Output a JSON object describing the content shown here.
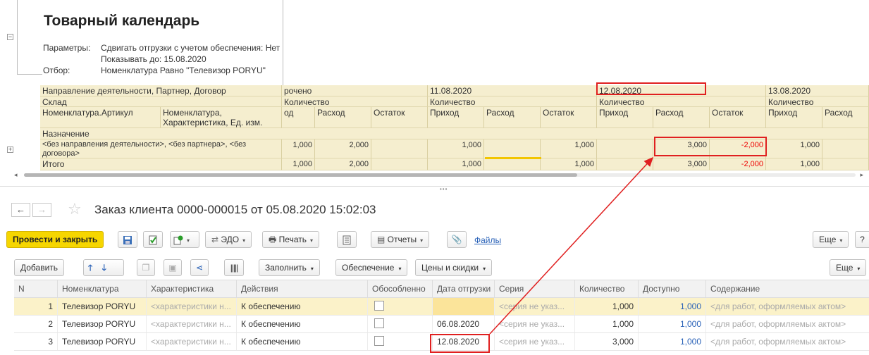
{
  "report": {
    "title": "Товарный календарь",
    "params": [
      {
        "label": "Параметры:",
        "value": "Сдвигать отгрузки с учетом обеспечения: Нет"
      },
      {
        "label": "",
        "value": "Показывать до: 15.08.2020"
      },
      {
        "label": "Отбор:",
        "value": "Номенклатура Равно \"Телевизор PORYU\""
      }
    ],
    "grid": {
      "hdr_direction": "Направление деятельности, Партнер, Договор",
      "hdr_warehouse": "Склад",
      "hdr_article": "Номенклатура.Артикул",
      "hdr_characteristic": "Номенклатура, Характеристика, Ед. изм.",
      "hdr_purpose": "Назначение",
      "overdue_label": "рочено",
      "qty_label": "Количество",
      "col_in_partial": "од",
      "dates": [
        "11.08.2020",
        "12.08.2020",
        "13.08.2020"
      ],
      "col_in": "Приход",
      "col_out": "Расход",
      "col_rest": "Остаток",
      "row_label": "<без направления деятельности>, <без партнера>, <без договора>",
      "row_vals": [
        "1,000",
        "2,000",
        "",
        "1,000",
        "",
        "1,000",
        "",
        "3,000",
        "-2,000",
        "1,000"
      ],
      "total_label": "Итого",
      "total_vals": [
        "1,000",
        "2,000",
        "",
        "1,000",
        "",
        "1,000",
        "",
        "3,000",
        "-2,000",
        "1,000"
      ]
    }
  },
  "doc": {
    "title": "Заказ клиента 0000-000015 от 05.08.2020 15:02:03",
    "buttons": {
      "post_close": "Провести и закрыть",
      "edo": "ЭДО",
      "print": "Печать",
      "reports": "Отчеты",
      "files": "Файлы",
      "more": "Еще",
      "help": "?"
    },
    "table_toolbar": {
      "add": "Добавить",
      "fill": "Заполнить",
      "supply": "Обеспечение",
      "prices": "Цены и скидки",
      "more": "Еще"
    },
    "columns": [
      "N",
      "Номенклатура",
      "Характеристика",
      "Действия",
      "Обособленно",
      "Дата отгрузки",
      "Серия",
      "Количество",
      "Доступно",
      "Содержание"
    ],
    "rows": [
      {
        "n": "1",
        "item": "Телевизор PORYU",
        "char": "<характеристики н...",
        "action": "К обеспечению",
        "date": "",
        "series": "<серия не указ...",
        "qty": "1,000",
        "avail": "1,000",
        "content": "<для работ, оформляемых актом>"
      },
      {
        "n": "2",
        "item": "Телевизор PORYU",
        "char": "<характеристики н...",
        "action": "К обеспечению",
        "date": "06.08.2020",
        "series": "<серия не указ...",
        "qty": "1,000",
        "avail": "1,000",
        "content": "<для работ, оформляемых актом>"
      },
      {
        "n": "3",
        "item": "Телевизор PORYU",
        "char": "<характеристики н...",
        "action": "К обеспечению",
        "date": "12.08.2020",
        "series": "<серия не указ...",
        "qty": "3,000",
        "avail": "1,000",
        "content": "<для работ, оформляемых актом>"
      }
    ]
  },
  "colors": {
    "accent": "#f6d600",
    "highlight": "#e02020",
    "grid_bg": "#f5eecf",
    "link": "#2a62b8"
  }
}
